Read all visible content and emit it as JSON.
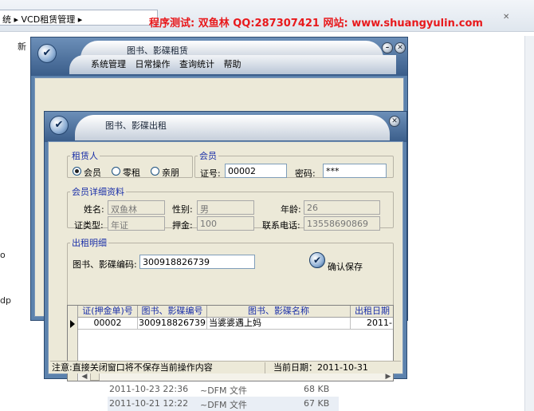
{
  "explorer": {
    "address_prefix": "统",
    "address_path": "VCD租赁管理",
    "banner": "程序测试: 双鱼林 QQ:287307421  网站: www.shuangyulin.com",
    "toolbar_new": "新",
    "left_fragments": [
      "o",
      "dp"
    ],
    "files": [
      {
        "date": "2011-10-23 22:36",
        "type": "~DFM 文件",
        "size": "68 KB"
      },
      {
        "date": "2011-10-21 12:22",
        "type": "~DFM 文件",
        "size": "67 KB"
      }
    ]
  },
  "main_window": {
    "title": "图书、影碟租赁",
    "menu": [
      "系统管理",
      "日常操作",
      "查询统计",
      "帮助"
    ]
  },
  "dialog": {
    "title": "图书、影碟出租",
    "renter_group": {
      "legend": "租赁人",
      "options": [
        {
          "label": "会员",
          "selected": true
        },
        {
          "label": "零租",
          "selected": false
        },
        {
          "label": "亲朋",
          "selected": false
        }
      ]
    },
    "member_group": {
      "legend": "会员",
      "card_label": "证号:",
      "card_value": "00002",
      "password_label": "密码:",
      "password_value": "***"
    },
    "details": {
      "legend": "会员详细资料",
      "name_label": "姓名:",
      "name_value": "双鱼林",
      "gender_label": "性别:",
      "gender_value": "男",
      "age_label": "年龄:",
      "age_value": "26",
      "idtype_label": "证类型:",
      "idtype_value": "年证",
      "deposit_label": "押金:",
      "deposit_value": "100",
      "phone_label": "联系电话:",
      "phone_value": "13558690869"
    },
    "rental": {
      "legend": "出租明细",
      "code_label": "图书、影碟编码:",
      "code_value": "300918826739",
      "confirm_label": "确认保存",
      "columns": [
        "证(押金单)号",
        "图书、影碟编号",
        "图书、影碟名称",
        "出租日期"
      ],
      "rows": [
        [
          "00002",
          "300918826739",
          "当婆婆遇上妈",
          "2011-"
        ]
      ]
    },
    "status": {
      "note": "注意:直接关闭窗口将不保存当前操作内容",
      "date": "当前日期：2011-10-31"
    }
  }
}
